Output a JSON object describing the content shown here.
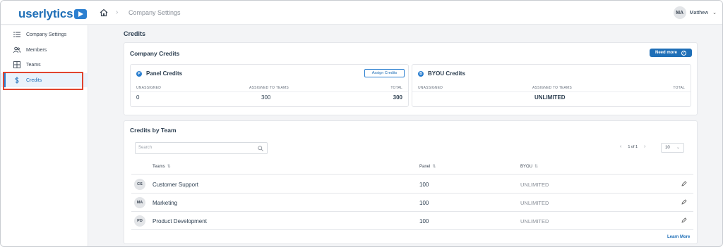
{
  "header": {
    "logo": "userlytics",
    "breadcrumb": "Company Settings",
    "user_initials": "MA",
    "user_name": "Matthew"
  },
  "sidebar": {
    "items": [
      {
        "label": "Company Settings",
        "icon": "list-icon"
      },
      {
        "label": "Members",
        "icon": "users-icon"
      },
      {
        "label": "Teams",
        "icon": "grid-icon"
      },
      {
        "label": "Credits",
        "icon": "dollar-icon",
        "active": true
      }
    ]
  },
  "page": {
    "title": "Credits"
  },
  "company_credits": {
    "title": "Company Credits",
    "need_more": "Need more",
    "panel": {
      "title": "Panel Credits",
      "assign_label": "Assign Credits",
      "labels": [
        "UNASSIGNED",
        "ASSIGNED TO TEAMS",
        "TOTAL"
      ],
      "values": [
        "0",
        "300",
        "300"
      ]
    },
    "byou": {
      "title": "BYOU Credits",
      "labels": [
        "UNASSIGNED",
        "ASSIGNED TO TEAMS",
        "TOTAL"
      ],
      "values": [
        "",
        "UNLIMITED",
        ""
      ]
    }
  },
  "credits_by_team": {
    "title": "Credits by Team",
    "search_placeholder": "Search",
    "pager_text": "1 of 1",
    "per_page": "10",
    "columns": [
      "Teams",
      "Panel",
      "BYOU"
    ],
    "rows": [
      {
        "initials": "CS",
        "name": "Customer Support",
        "panel": "100",
        "byou": "UNLIMITED"
      },
      {
        "initials": "MA",
        "name": "Marketing",
        "panel": "100",
        "byou": "UNLIMITED"
      },
      {
        "initials": "PD",
        "name": "Product Development",
        "panel": "100",
        "byou": "UNLIMITED"
      }
    ],
    "learn_more": "Learn More"
  },
  "colors": {
    "accent": "#1f6fb7",
    "highlight": "#e0442f"
  }
}
